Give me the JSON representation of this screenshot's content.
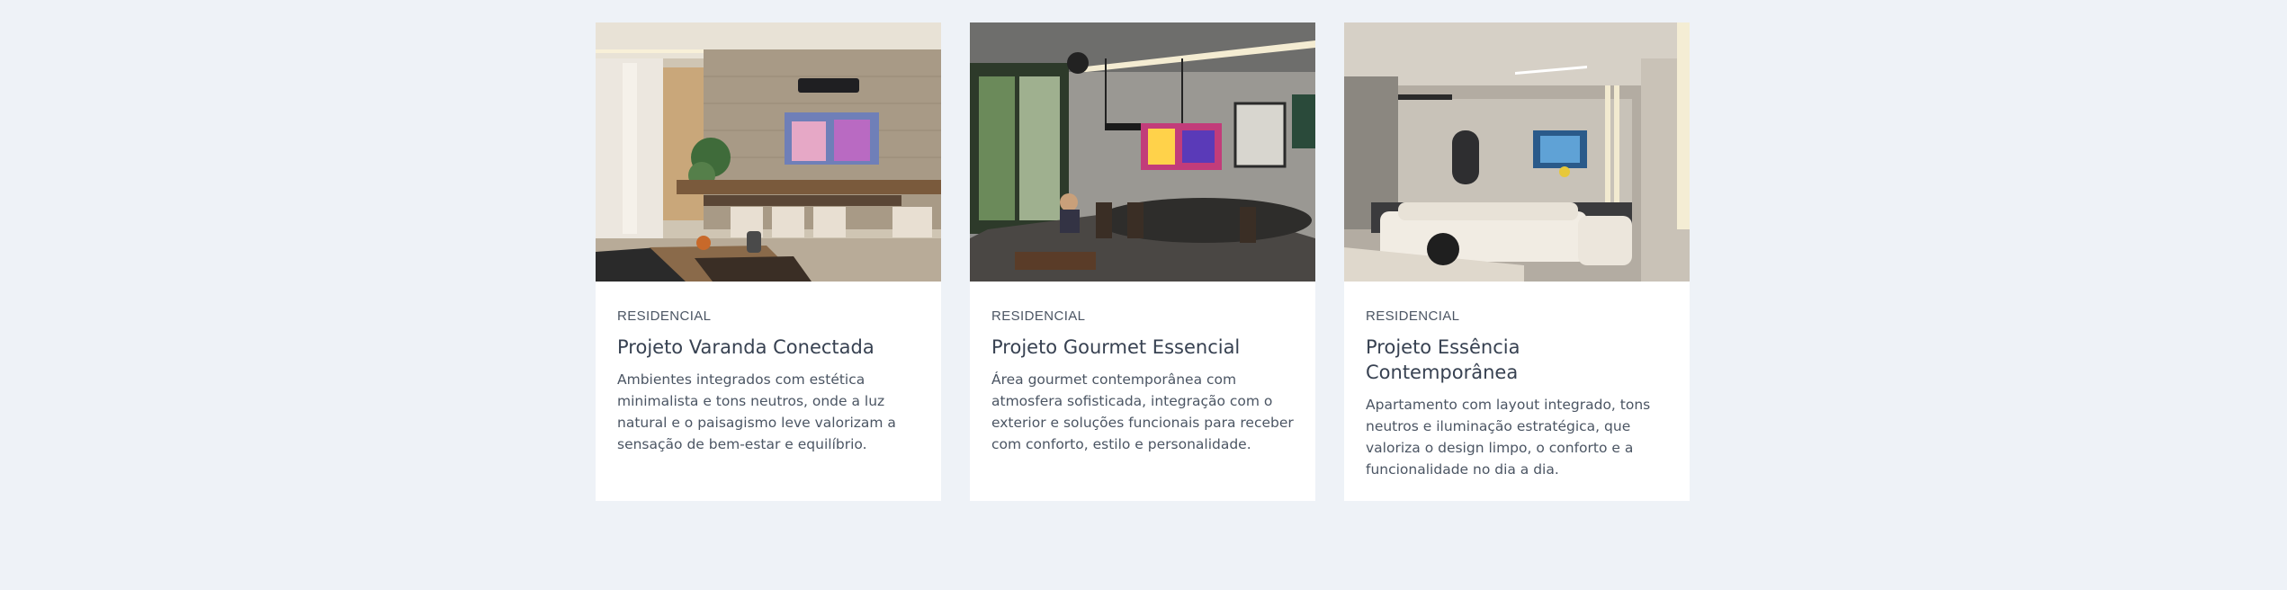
{
  "projects": [
    {
      "category": "RESIDENCIAL",
      "title": "Projeto Varanda Conectada",
      "description": "Ambientes integrados com estética minimalista e tons neutros, onde a luz natural e o paisagismo leve valorizam a sensação de bem-estar e equilíbrio.",
      "image": "living-room-photo"
    },
    {
      "category": "RESIDENCIAL",
      "title": "Projeto Gourmet Essencial",
      "description": "Área gourmet contemporânea com atmosfera sofisticada, integração com o exterior e soluções funcionais para receber com conforto, estilo e personalidade.",
      "image": "gourmet-area-photo"
    },
    {
      "category": "RESIDENCIAL",
      "title": "Projeto Essência Contemporânea",
      "description": "Apartamento com layout integrado, tons neutros e iluminação estratégica, que valoriza o design limpo, o conforto e a funcionalidade no dia a dia.",
      "image": "apartment-photo"
    }
  ]
}
